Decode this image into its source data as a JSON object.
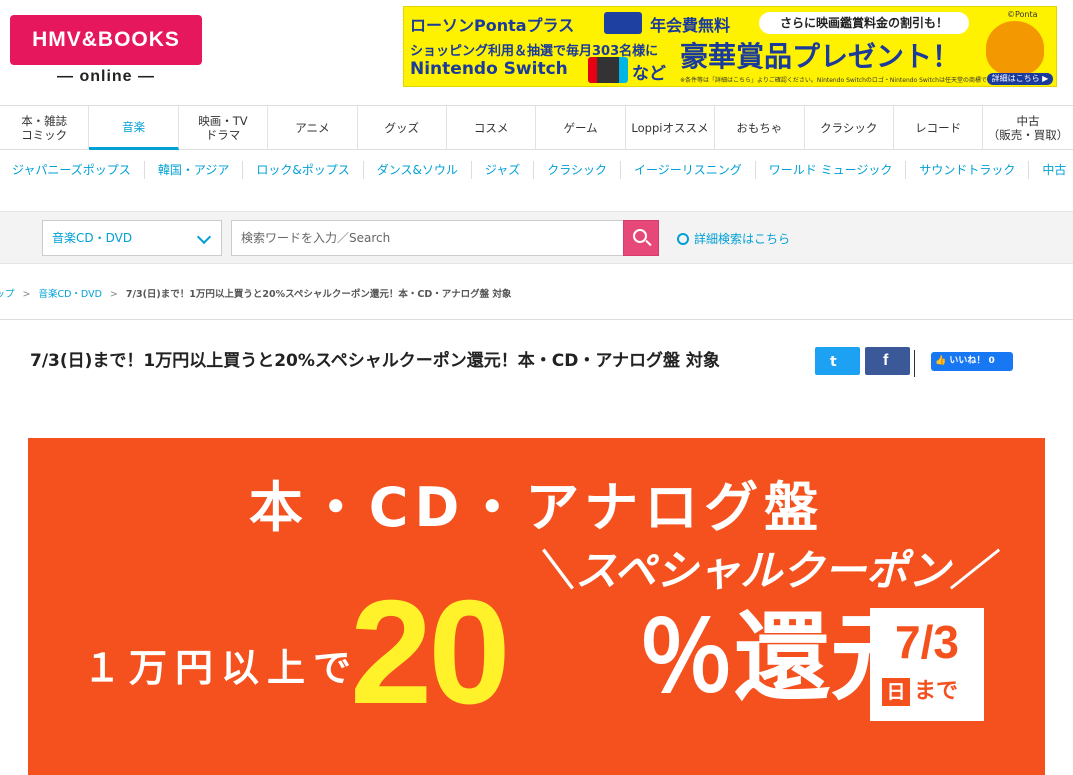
{
  "header": {
    "logo_text": "HMV&BOOKS",
    "logo_sub": "— online —",
    "ad": {
      "line1": "ローソンPontaプラス",
      "fee": "年会費無料",
      "pill": "さらに映画鑑賞料金の割引も！",
      "ponta_copy": "©Ponta",
      "line2": "ショッピング利用＆抽選で毎月303名様に",
      "line3": "Nintendo Switch",
      "nado": "など",
      "big": "豪華賞品プレゼント！",
      "note": "※条件等は「詳細はこちら」よりご確認ください。Nintendo Switchのロゴ・Nintendo Switchは任天堂の商標です。",
      "detail": "詳細はこちら ▶"
    }
  },
  "nav_primary": [
    {
      "label": "本・雑誌\nコミック",
      "active": false
    },
    {
      "label": "音楽",
      "active": true
    },
    {
      "label": "映画・TV\nドラマ",
      "active": false
    },
    {
      "label": "アニメ",
      "active": false
    },
    {
      "label": "グッズ",
      "active": false
    },
    {
      "label": "コスメ",
      "active": false
    },
    {
      "label": "ゲーム",
      "active": false
    },
    {
      "label": "Loppiオススメ",
      "active": false
    },
    {
      "label": "おもちゃ",
      "active": false
    },
    {
      "label": "クラシック",
      "active": false
    },
    {
      "label": "レコード",
      "active": false
    },
    {
      "label": "中古\n（販売・買取）",
      "active": false
    }
  ],
  "nav_secondary": [
    "ジャパニーズポップス",
    "韓国・アジア",
    "ロック&ポップス",
    "ダンス&ソウル",
    "ジャズ",
    "クラシック",
    "イージーリスニング",
    "ワールド ミュージック",
    "サウンドトラック",
    "中古"
  ],
  "search": {
    "category": "音楽CD・DVD",
    "placeholder": "検索ワードを入力／Search",
    "advanced": "詳細検索はこちら"
  },
  "breadcrumb": {
    "top": "トップ",
    "sep": ">",
    "cat": "音楽CD・DVD",
    "current": "7/3(日)まで！1万円以上買うと20%スペシャルクーポン還元！本・CD・アナログ盤 対象"
  },
  "article": {
    "title": "7/3(日)まで！1万円以上買うと20%スペシャルクーポン還元！本・CD・アナログ盤 対象",
    "twitter_icon": "t",
    "facebook_icon": "f",
    "like_label": "👍 いいね！ 0"
  },
  "hero": {
    "line1": "本・CD・アナログ盤",
    "coupon": "＼スペシャルクーポン／",
    "condition": "１万円以上で",
    "percent_num": "20",
    "percent_tail": "％還元",
    "date": "7/3",
    "day": "日",
    "made": "まで"
  },
  "colors": {
    "brand": "#e6175c",
    "accent": "#00a0d6",
    "hero_bg": "#f4511e",
    "hero_yellow": "#fff22a"
  }
}
